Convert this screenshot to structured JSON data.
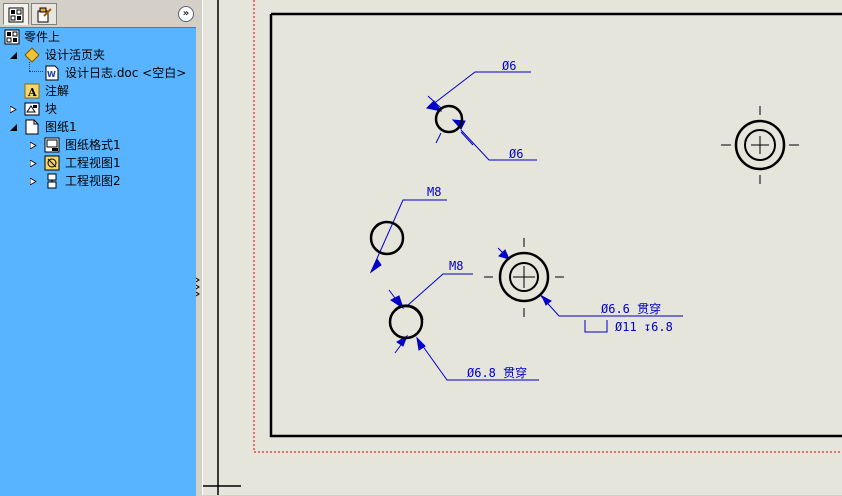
{
  "panel": {
    "tabs": [
      {
        "name": "feature-manager-tab",
        "icon": "feature-tree-icon"
      },
      {
        "name": "property-manager-tab",
        "icon": "property-manager-icon"
      }
    ],
    "collapse_label": "»"
  },
  "tree": {
    "root": {
      "label": "零件上",
      "icon": "drawing-document-icon"
    },
    "items": [
      {
        "label": "设计活页夹",
        "icon": "design-binder-icon",
        "expanded": true
      },
      {
        "label": "设计日志.doc <空白>",
        "icon": "word-document-icon"
      },
      {
        "label": "注解",
        "icon": "annotations-icon"
      },
      {
        "label": "块",
        "icon": "blocks-icon",
        "expanded": false
      },
      {
        "label": "图纸1",
        "icon": "sheet-icon",
        "expanded": true
      },
      {
        "label": "图纸格式1",
        "icon": "sheet-format-icon",
        "expanded": false
      },
      {
        "label": "工程视图1",
        "icon": "drawing-view-icon",
        "expanded": false
      },
      {
        "label": "工程视图2",
        "icon": "drawing-view-icon",
        "expanded": false
      }
    ]
  },
  "drawing": {
    "annotations": {
      "dia6_top": "Ø6",
      "dia6_bottom": "Ø6",
      "m8_top": "M8",
      "m8_mid": "M8",
      "dia68_thru": "Ø6.8 贯穿",
      "dia66_thru": "Ø6.6 贯穿",
      "cbore": "Ø11 ↧6.8"
    },
    "colors": {
      "annotation": "#0000c8",
      "sheet_border": "#000000",
      "margin": "#e00000"
    }
  }
}
